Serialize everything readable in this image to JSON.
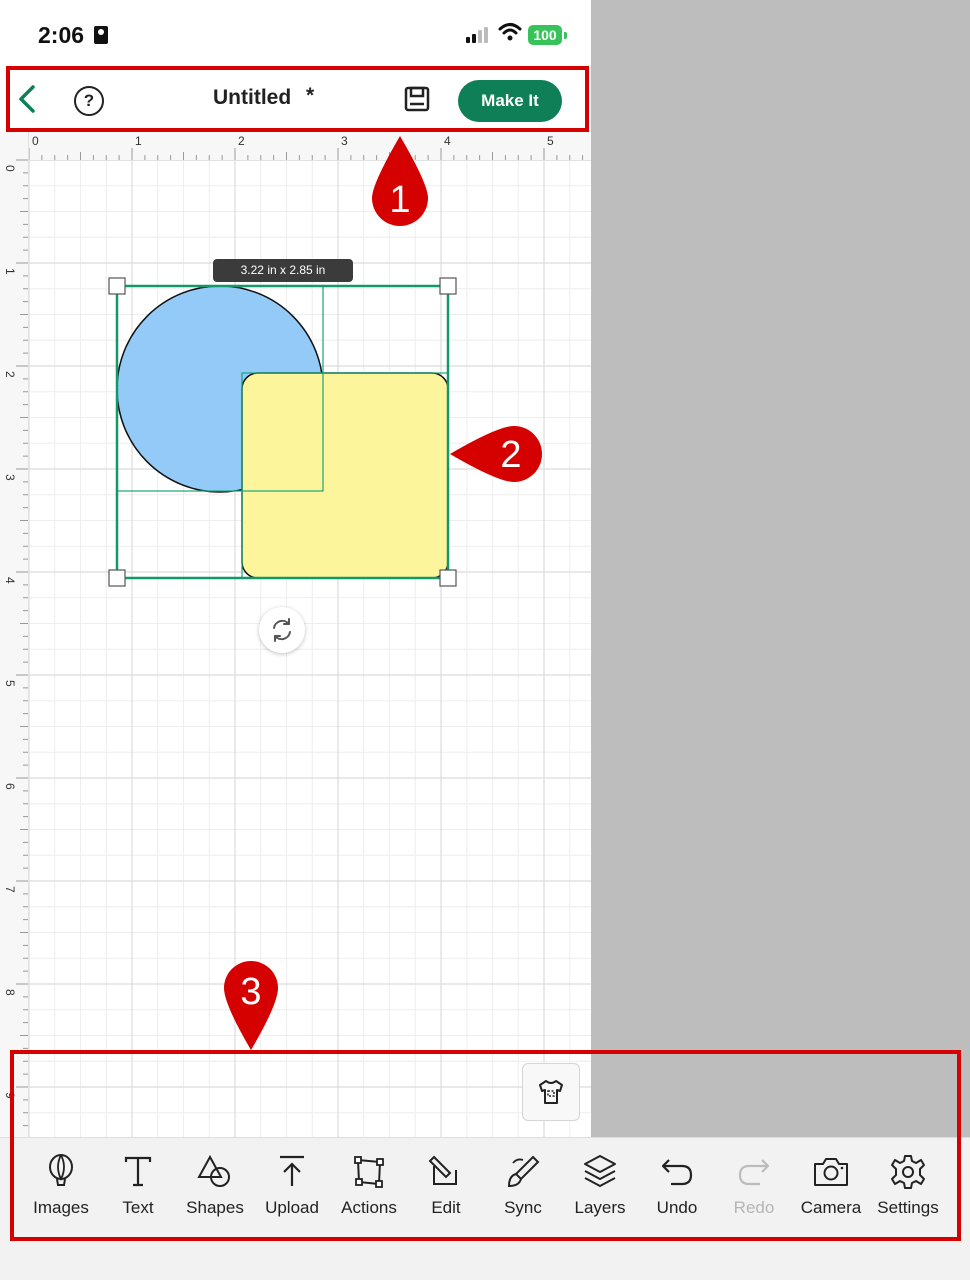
{
  "status_bar": {
    "time": "2:06",
    "battery": "100"
  },
  "header": {
    "title": "Untitled",
    "unsaved_marker": "*",
    "make_it_label": "Make It"
  },
  "rulers": {
    "horizontal": [
      "0",
      "1",
      "2",
      "3",
      "4",
      "5"
    ],
    "vertical": [
      "0",
      "1",
      "2",
      "3",
      "4",
      "5",
      "6",
      "7",
      "8",
      "9"
    ]
  },
  "selection": {
    "size_label": "3.22 in x 2.85 in"
  },
  "canvas_shapes": [
    {
      "name": "circle",
      "fill": "#94caf7"
    },
    {
      "name": "rounded-square",
      "fill": "#fdf59b"
    }
  ],
  "accent_color": "#0f7f58",
  "toolbar": {
    "items": [
      {
        "label": "Images",
        "icon": "balloon-icon",
        "enabled": true
      },
      {
        "label": "Text",
        "icon": "text-icon",
        "enabled": true
      },
      {
        "label": "Shapes",
        "icon": "shapes-icon",
        "enabled": true
      },
      {
        "label": "Upload",
        "icon": "upload-icon",
        "enabled": true
      },
      {
        "label": "Actions",
        "icon": "actions-icon",
        "enabled": true
      },
      {
        "label": "Edit",
        "icon": "edit-icon",
        "enabled": true
      },
      {
        "label": "Sync",
        "icon": "sync-icon",
        "enabled": true
      },
      {
        "label": "Layers",
        "icon": "layers-icon",
        "enabled": true
      },
      {
        "label": "Undo",
        "icon": "undo-icon",
        "enabled": true
      },
      {
        "label": "Redo",
        "icon": "redo-icon",
        "enabled": false
      },
      {
        "label": "Camera",
        "icon": "camera-icon",
        "enabled": true
      },
      {
        "label": "Settings",
        "icon": "settings-icon",
        "enabled": true
      }
    ]
  },
  "callouts": [
    "1",
    "2",
    "3"
  ],
  "callout_color": "#d50000"
}
